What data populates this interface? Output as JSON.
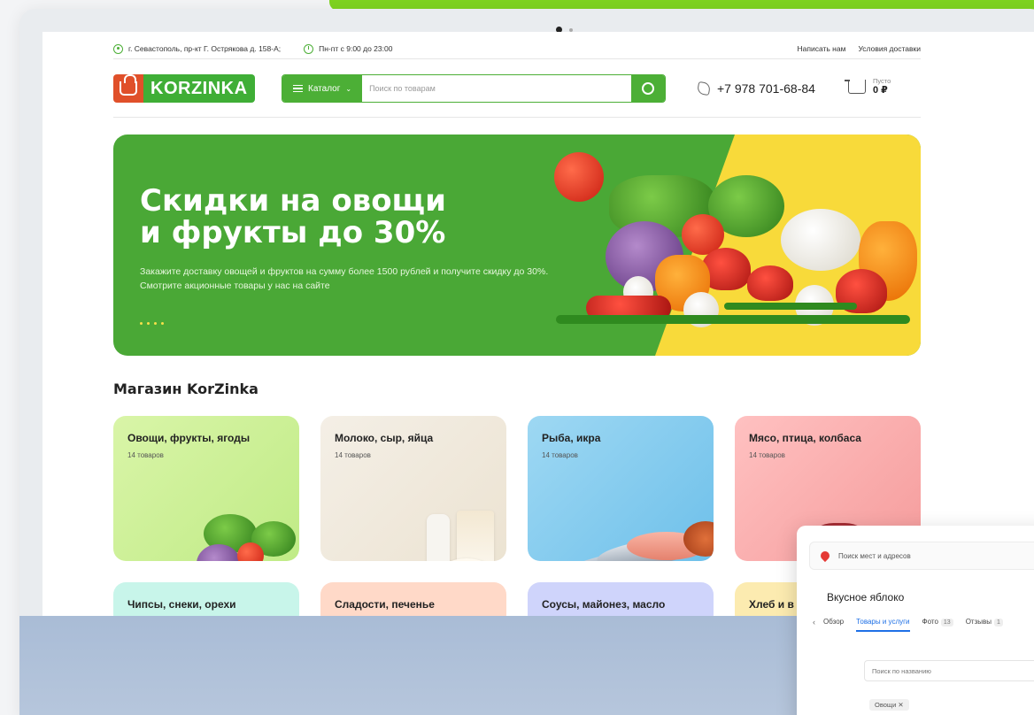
{
  "topbar": {
    "address": "г. Севастополь, пр-кт Г. Острякова д. 158-А;",
    "hours": "Пн-пт с 9:00 до 23:00",
    "links": [
      "Написать нам",
      "Условия доставки"
    ]
  },
  "header": {
    "logo_text": "KORZINKA",
    "catalog_label": "Каталог",
    "search_placeholder": "Поиск по товарам",
    "phone": "+7 978 701-68-84",
    "cart_status": "Пусто",
    "cart_total": "0 ₽"
  },
  "hero": {
    "title_line1": "Скидки на овощи",
    "title_line2": "и фрукты до 30%",
    "text": "Закажите доставку овощей и фруктов на сумму более 1500 рублей и получите скидку до 30%. Смотрите акционные товары у нас на сайте"
  },
  "store": {
    "title": "Магазин KorZinka",
    "categories": [
      {
        "name": "Овощи, фрукты, ягоды",
        "count": "14 товаров"
      },
      {
        "name": "Молоко, сыр, яйца",
        "count": "14 товаров"
      },
      {
        "name": "Рыба, икра",
        "count": "14 товаров"
      },
      {
        "name": "Мясо, птица, колбаса",
        "count": "14 товаров"
      },
      {
        "name": "Чипсы, снеки, орехи"
      },
      {
        "name": "Сладости, печенье"
      },
      {
        "name": "Соусы, майонез, масло"
      },
      {
        "name": "Хлеб и в"
      }
    ]
  },
  "map_widget": {
    "search_placeholder": "Поиск мест и адресов",
    "place_name": "Вкусное яблоко",
    "tabs": [
      {
        "label": "Обзор"
      },
      {
        "label": "Товары и услуги"
      },
      {
        "label": "Фото",
        "badge": "13"
      },
      {
        "label": "Отзывы",
        "badge": "1"
      }
    ],
    "filter_placeholder": "Поиск по названию",
    "chip": "Овощи ✕"
  },
  "colors": {
    "brand_green": "#4caf36",
    "logo_orange": "#e0502a",
    "hero_yellow": "#f8da3a",
    "tab_active": "#1e70e6"
  }
}
